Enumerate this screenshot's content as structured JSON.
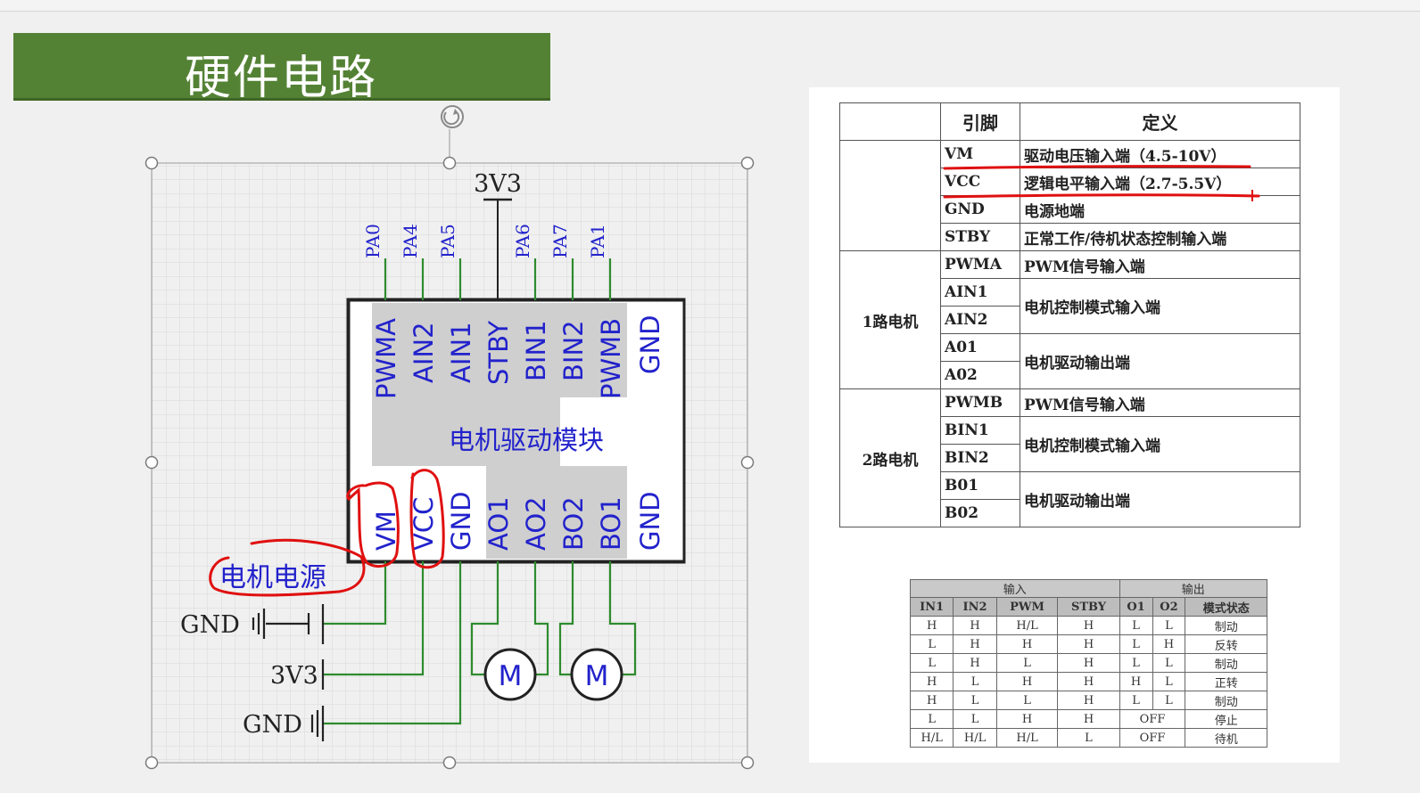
{
  "slide": {
    "title": "硬件电路",
    "accent": "#548235"
  },
  "circuit": {
    "top_supply": "3V3",
    "top_pins": [
      "PA0",
      "PA4",
      "PA5",
      "PA6",
      "PA7",
      "PA1"
    ],
    "module_top_pins": [
      "PWMA",
      "AIN2",
      "AIN1",
      "STBY",
      "BIN1",
      "BIN2",
      "PWMB",
      "GND"
    ],
    "module_bottom_pins": [
      "VM",
      "VCC",
      "GND",
      "AO1",
      "AO2",
      "BO2",
      "BO1",
      "GND"
    ],
    "module_label": "电机驱动模块",
    "power_label": "电机电源",
    "left_gnd_1": "GND",
    "left_3v3": "3V3",
    "left_gnd_2": "GND",
    "motor_a": "M",
    "motor_b": "M",
    "wire_color": "#2e8b2e",
    "pin_text_color": "#2222cc",
    "annotation_color": "#e01010"
  },
  "pin_table": {
    "header_pin": "引脚",
    "header_def": "定义",
    "group_1": "1路电机",
    "group_2": "2路电机",
    "rows": [
      {
        "pin": "VM",
        "def": "驱动电压输入端（4.5-10V）"
      },
      {
        "pin": "VCC",
        "def": "逻辑电平输入端（2.7-5.5V）"
      },
      {
        "pin": "GND",
        "def": "电源地端"
      },
      {
        "pin": "STBY",
        "def": "正常工作/待机状态控制输入端"
      },
      {
        "pin": "PWMA",
        "def": "PWM信号输入端"
      },
      {
        "pin": "AIN1",
        "def": "电机控制模式输入端"
      },
      {
        "pin": "AIN2",
        "def": ""
      },
      {
        "pin": "A01",
        "def": "电机驱动输出端"
      },
      {
        "pin": "A02",
        "def": ""
      },
      {
        "pin": "PWMB",
        "def": "PWM信号输入端"
      },
      {
        "pin": "BIN1",
        "def": "电机控制模式输入端"
      },
      {
        "pin": "BIN2",
        "def": ""
      },
      {
        "pin": "B01",
        "def": "电机驱动输出端"
      },
      {
        "pin": "B02",
        "def": ""
      }
    ]
  },
  "truth_table": {
    "input_label": "输入",
    "output_label": "输出",
    "headers": [
      "IN1",
      "IN2",
      "PWM",
      "STBY",
      "O1",
      "O2",
      "模式状态"
    ],
    "rows": [
      [
        "H",
        "H",
        "H/L",
        "H",
        "L",
        "L",
        "制动"
      ],
      [
        "L",
        "H",
        "H",
        "H",
        "L",
        "H",
        "反转"
      ],
      [
        "L",
        "H",
        "L",
        "H",
        "L",
        "L",
        "制动"
      ],
      [
        "H",
        "L",
        "H",
        "H",
        "H",
        "L",
        "正转"
      ],
      [
        "H",
        "L",
        "L",
        "H",
        "L",
        "L",
        "制动"
      ],
      [
        "L",
        "L",
        "H",
        "H",
        "OFF",
        "",
        "停止"
      ],
      [
        "H/L",
        "H/L",
        "H/L",
        "L",
        "OFF",
        "",
        "待机"
      ]
    ]
  }
}
